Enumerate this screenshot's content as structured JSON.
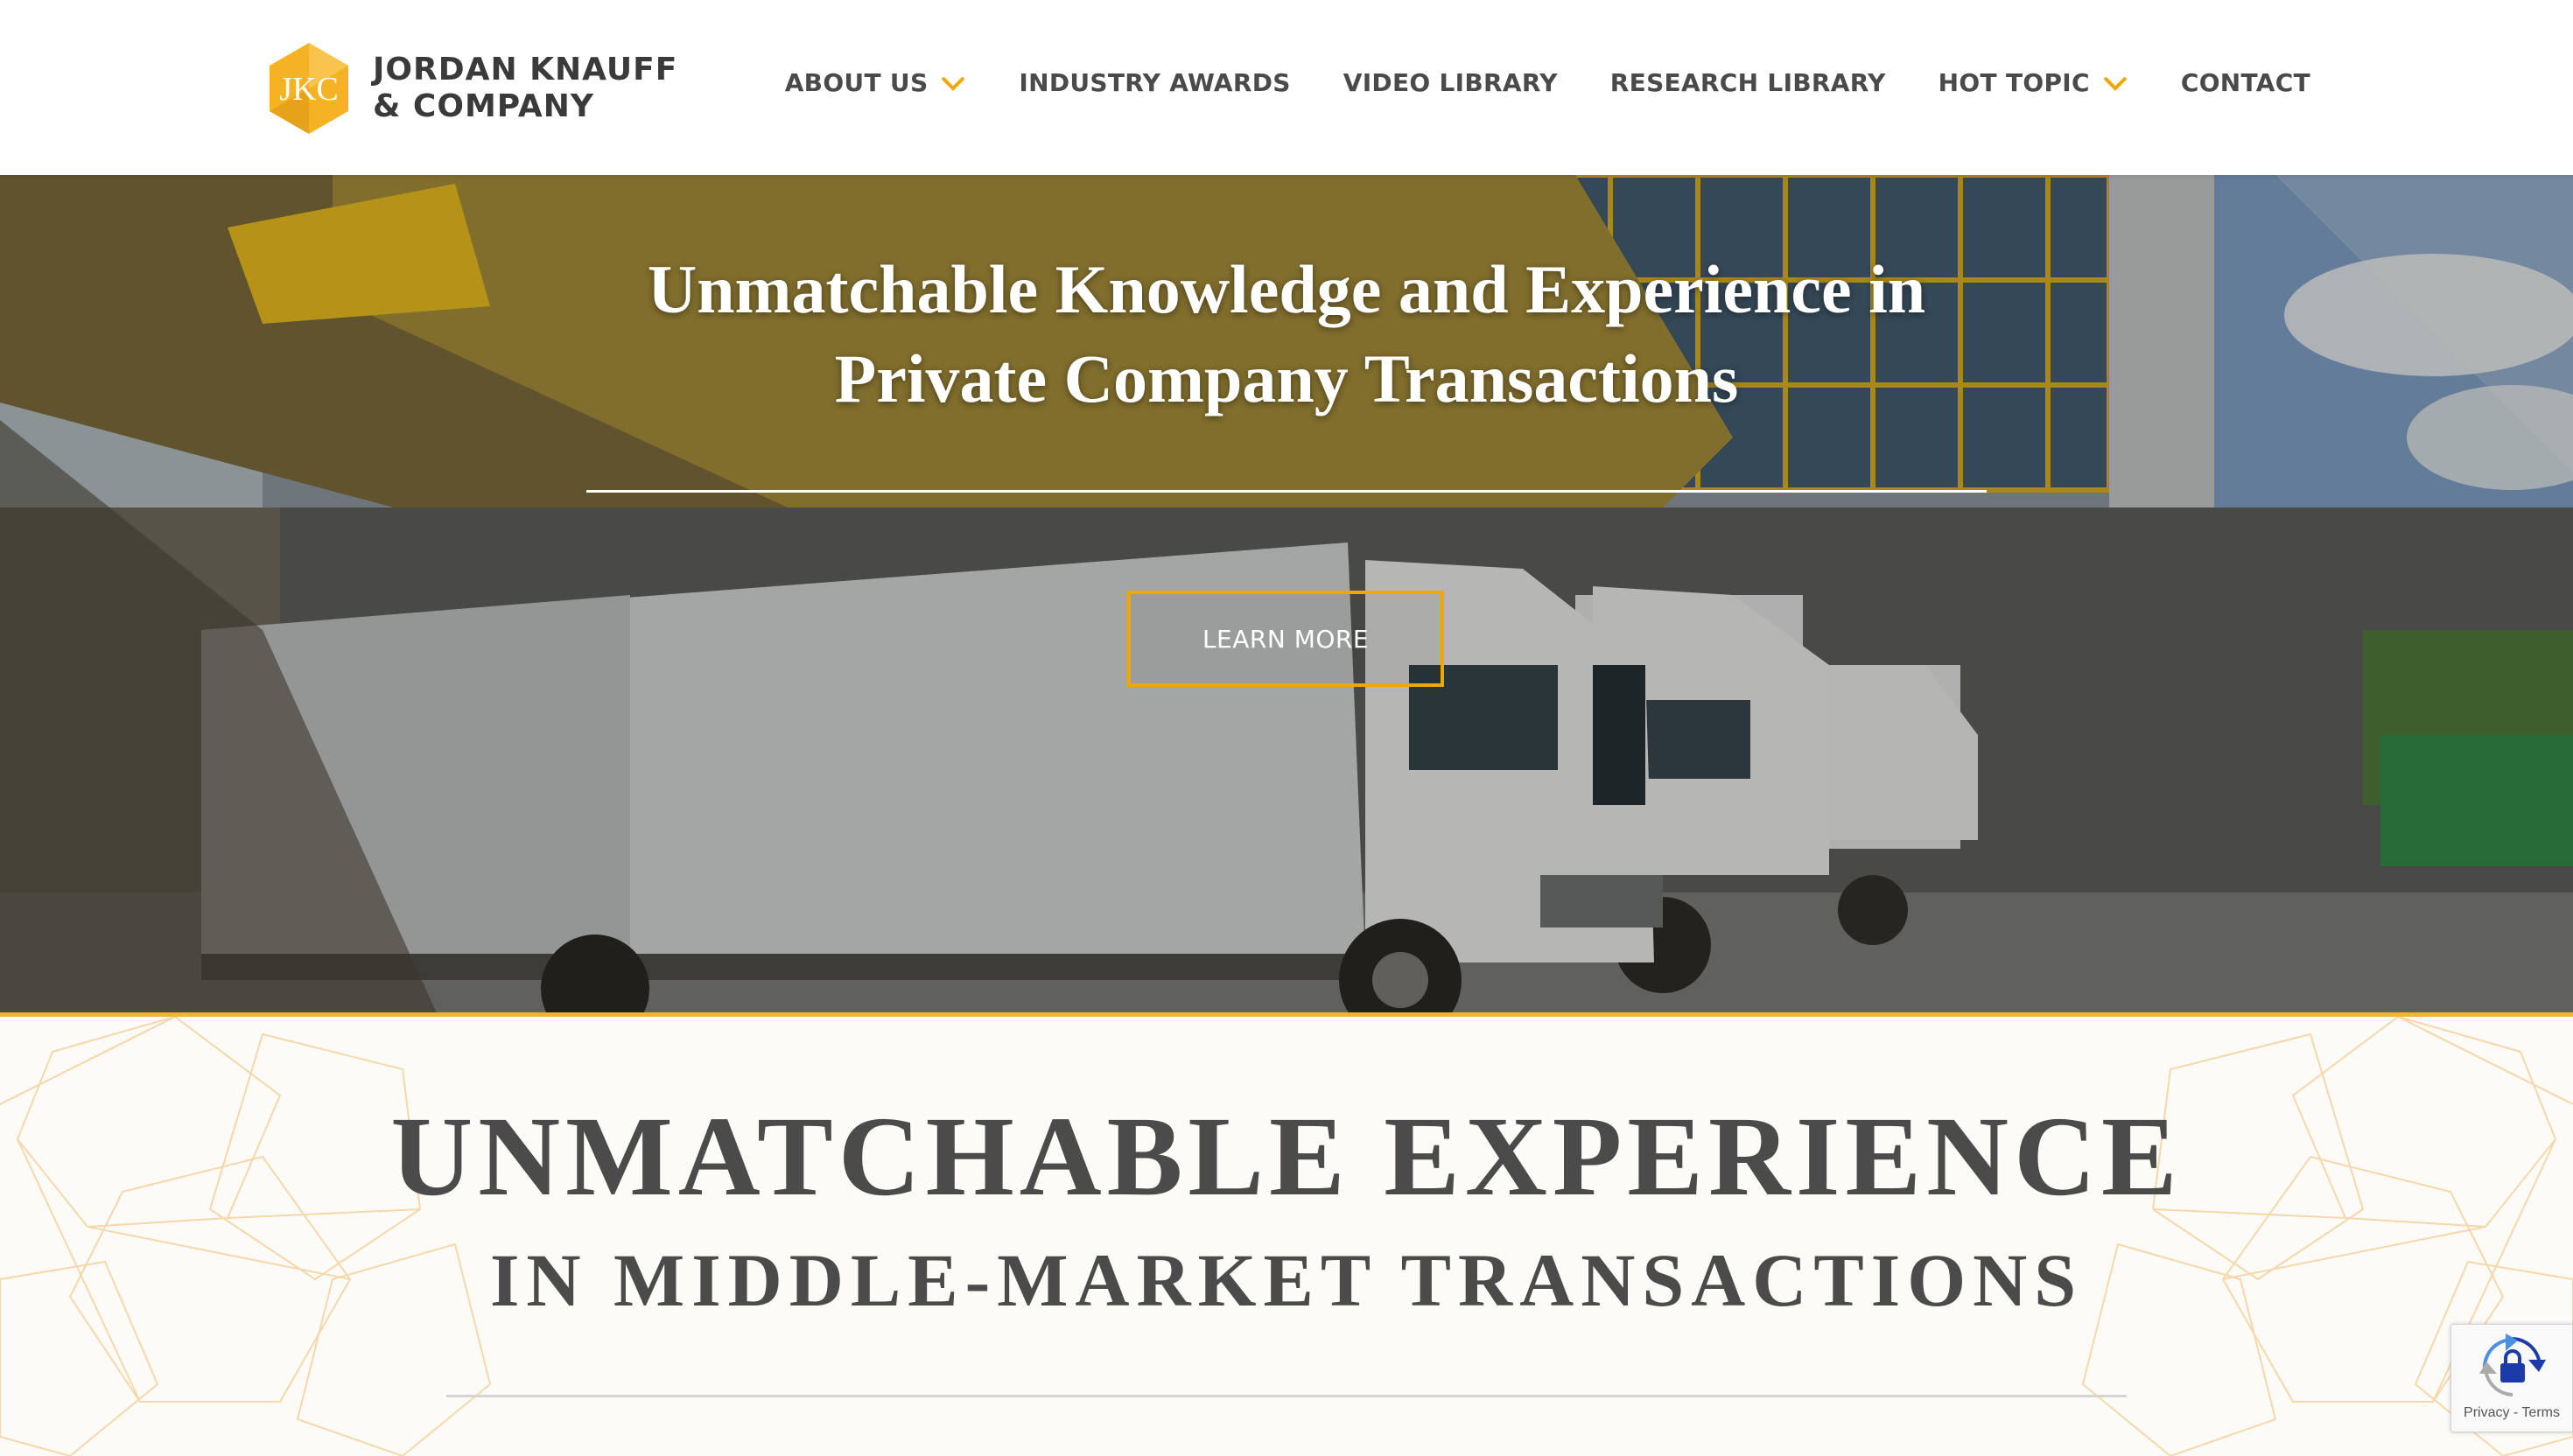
{
  "header": {
    "logo": {
      "monogram": "JKC",
      "line1": "JORDAN KNAUFF",
      "line2": "& COMPANY"
    },
    "nav": [
      {
        "label": "ABOUT US",
        "has_dropdown": true
      },
      {
        "label": "INDUSTRY AWARDS",
        "has_dropdown": false
      },
      {
        "label": "VIDEO LIBRARY",
        "has_dropdown": false
      },
      {
        "label": "RESEARCH LIBRARY",
        "has_dropdown": false
      },
      {
        "label": "HOT TOPIC",
        "has_dropdown": true
      },
      {
        "label": "CONTACT",
        "has_dropdown": false
      }
    ]
  },
  "hero": {
    "title_line1": "Unmatchable Knowledge and Experience in",
    "title_line2": "Private Company Transactions",
    "button_label": "LEARN MORE"
  },
  "section": {
    "title_line1": "UNMATCHABLE EXPERIENCE",
    "title_line2": "IN MIDDLE-MARKET TRANSACTIONS"
  },
  "recaptcha": {
    "links": "Privacy - Terms"
  },
  "colors": {
    "accent": "#f0a800",
    "text_dark": "#4a4a4a",
    "white": "#ffffff"
  },
  "icons": {
    "logo": "jkc-hexagon-logo",
    "dropdown": "chevron-down-icon",
    "recaptcha": "recaptcha-icon"
  }
}
